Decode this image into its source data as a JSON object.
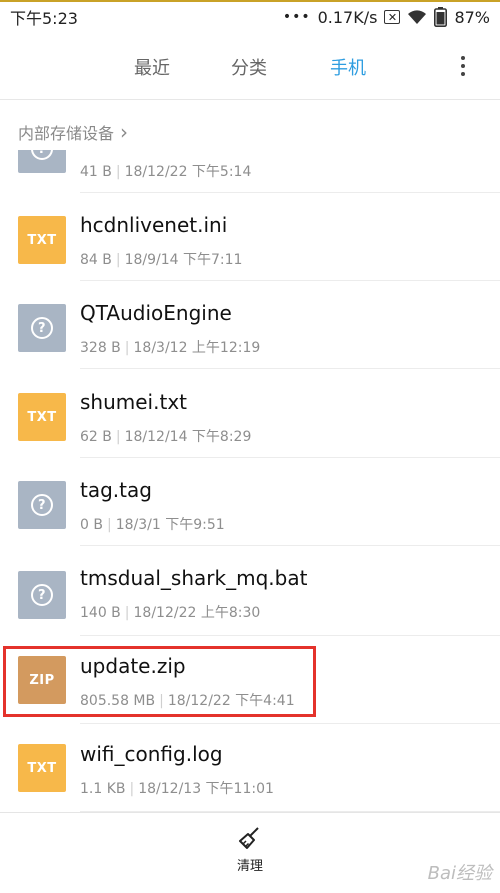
{
  "status": {
    "time": "下午5:23",
    "speed": "0.17K/s",
    "battery": "87%"
  },
  "tabs": [
    {
      "label": "最近",
      "active": false
    },
    {
      "label": "分类",
      "active": false
    },
    {
      "label": "手机",
      "active": true
    }
  ],
  "breadcrumb": {
    "label": "内部存储设备",
    "chevron": "›"
  },
  "files": [
    {
      "name": "",
      "icon": "unknown",
      "size": "41 B",
      "date": "18/12/22 下午5:14"
    },
    {
      "name": "hcdnlivenet.ini",
      "icon": "TXT",
      "size": "84 B",
      "date": "18/9/14 下午7:11"
    },
    {
      "name": "QTAudioEngine",
      "icon": "unknown",
      "size": "328 B",
      "date": "18/3/12 上午12:19"
    },
    {
      "name": "shumei.txt",
      "icon": "TXT",
      "size": "62 B",
      "date": "18/12/14 下午8:29"
    },
    {
      "name": "tag.tag",
      "icon": "unknown",
      "size": "0 B",
      "date": "18/3/1 下午9:51"
    },
    {
      "name": "tmsdual_shark_mq.bat",
      "icon": "unknown",
      "size": "140 B",
      "date": "18/12/22 上午8:30"
    },
    {
      "name": "update.zip",
      "icon": "ZIP",
      "size": "805.58 MB",
      "date": "18/12/22 下午4:41"
    },
    {
      "name": "wifi_config.log",
      "icon": "TXT",
      "size": "1.1 KB",
      "date": "18/12/13 下午11:01"
    }
  ],
  "bottom": {
    "clean_label": "清理"
  },
  "watermark": "Bai经验",
  "colors": {
    "accent": "#2e9de0",
    "txt": "#f7b84a",
    "unknown": "#a9b5c4",
    "zip": "#d39a5f",
    "highlight": "#e4322b"
  }
}
